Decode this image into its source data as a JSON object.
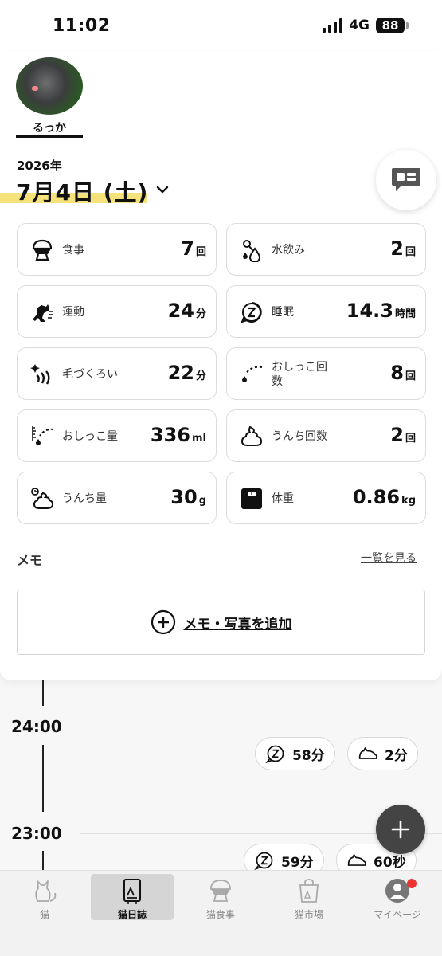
{
  "status": {
    "time": "11:02",
    "network": "4G",
    "battery": "88"
  },
  "cat": {
    "name": "るっか"
  },
  "date": {
    "year": "2026年",
    "day": "7月4日 (土)"
  },
  "stats": [
    {
      "label": "食事",
      "value": "7",
      "unit": "回",
      "icon": "food-bowl-icon"
    },
    {
      "label": "水飲み",
      "value": "2",
      "unit": "回",
      "icon": "water-drop-icon"
    },
    {
      "label": "運動",
      "value": "24",
      "unit": "分",
      "icon": "running-cat-icon"
    },
    {
      "label": "睡眠",
      "value": "14.3",
      "unit": "時間",
      "icon": "sleep-icon"
    },
    {
      "label": "毛づくろい",
      "value": "22",
      "unit": "分",
      "icon": "grooming-icon"
    },
    {
      "label": "おしっこ回数",
      "value": "8",
      "unit": "回",
      "icon": "pee-count-icon"
    },
    {
      "label": "おしっこ量",
      "value": "336",
      "unit": "ml",
      "icon": "pee-volume-icon"
    },
    {
      "label": "うんち回数",
      "value": "2",
      "unit": "回",
      "icon": "poop-count-icon"
    },
    {
      "label": "うんち量",
      "value": "30",
      "unit": "g",
      "icon": "poop-amount-icon"
    },
    {
      "label": "体重",
      "value": "0.86",
      "unit": "kg",
      "icon": "scale-icon"
    }
  ],
  "memo": {
    "title": "メモ",
    "see_all": "一覧を見る",
    "add": "メモ・写真を追加"
  },
  "timeline": {
    "hours": [
      "24:00",
      "23:00"
    ],
    "chips": [
      {
        "value": "58分",
        "icon": "sleep-icon"
      },
      {
        "value": "2分",
        "icon": "lying-cat-icon"
      },
      {
        "value": "59分",
        "icon": "sleep-icon"
      },
      {
        "value": "60秒",
        "icon": "lying-cat-icon"
      }
    ]
  },
  "nav": [
    {
      "label": "猫",
      "icon": "cat-icon"
    },
    {
      "label": "猫日誌",
      "icon": "diary-icon",
      "active": true
    },
    {
      "label": "猫食事",
      "icon": "food-bowl-icon"
    },
    {
      "label": "猫市場",
      "icon": "shopping-bag-icon"
    },
    {
      "label": "マイページ",
      "icon": "user-icon"
    }
  ],
  "colors": {
    "highlight": "#f6e27a",
    "fab": "#444444",
    "badge": "#e33333"
  }
}
